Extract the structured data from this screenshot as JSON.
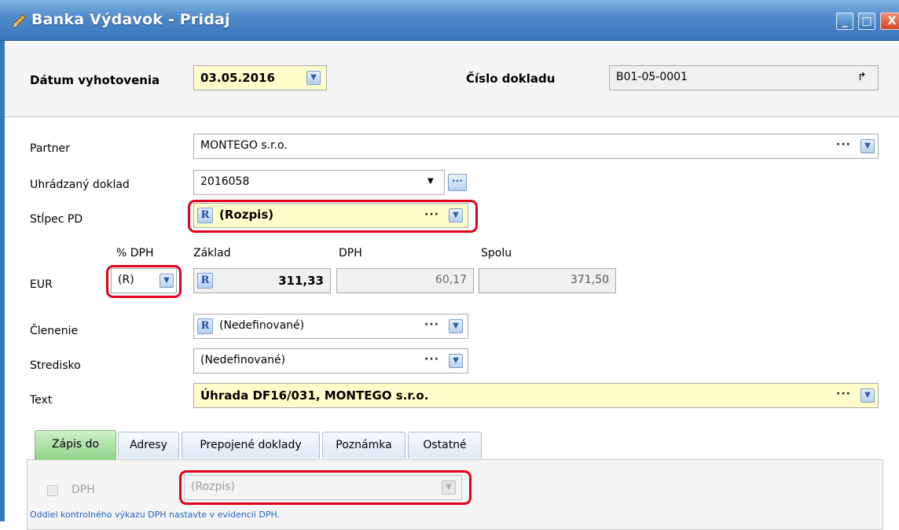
{
  "window": {
    "title": "Banka Výdavok - Pridaj",
    "buttons": {
      "minimize": "_",
      "maximize": "□",
      "close": "X"
    }
  },
  "header": {
    "date_label": "Dátum vyhotovenia",
    "date_value": "03.05.2016",
    "docnum_label": "Číslo dokladu",
    "docnum_value": "B01-05-0001",
    "docnum_icon": "↱"
  },
  "form": {
    "partner": {
      "label": "Partner",
      "value": "MONTEGO s.r.o."
    },
    "paid_doc": {
      "label": "Uhrádzaný doklad",
      "value": "2016058"
    },
    "column": {
      "label": "Stĺpec PD",
      "badge": "R",
      "value": "(Rozpis)"
    },
    "amounts": {
      "currency_label": "EUR",
      "vat_pct_label": "% DPH",
      "vat_pct_value": "(R)",
      "base_label": "Základ",
      "base_badge": "R",
      "base_value": "311,33",
      "vat_label": "DPH",
      "vat_value": "60,17",
      "total_label": "Spolu",
      "total_value": "371,50"
    },
    "division": {
      "label": "Členenie",
      "badge": "R",
      "value": "(Nedefinované)"
    },
    "center": {
      "label": "Stredisko",
      "value": "(Nedefinované)"
    },
    "text": {
      "label": "Text",
      "value": "Úhrada DF16/031, MONTEGO s.r.o."
    },
    "dots": "···"
  },
  "tabs": [
    {
      "label": "Zápis do"
    },
    {
      "label": "Adresy"
    },
    {
      "label": "Prepojené doklady"
    },
    {
      "label": "Poznámka"
    },
    {
      "label": "Ostatné"
    }
  ],
  "tab_panel": {
    "vat_checkbox_label": "DPH",
    "vat_select_value": "(Rozpis)",
    "note": "Oddiel kontrolného výkazu DPH nastavte v evidencii DPH."
  },
  "colors": {
    "titlebar": "#4d88c8",
    "highlight_yellow": "#ffffcc",
    "annotation_red": "#e2001a",
    "active_tab_green": "#8fd48a"
  }
}
